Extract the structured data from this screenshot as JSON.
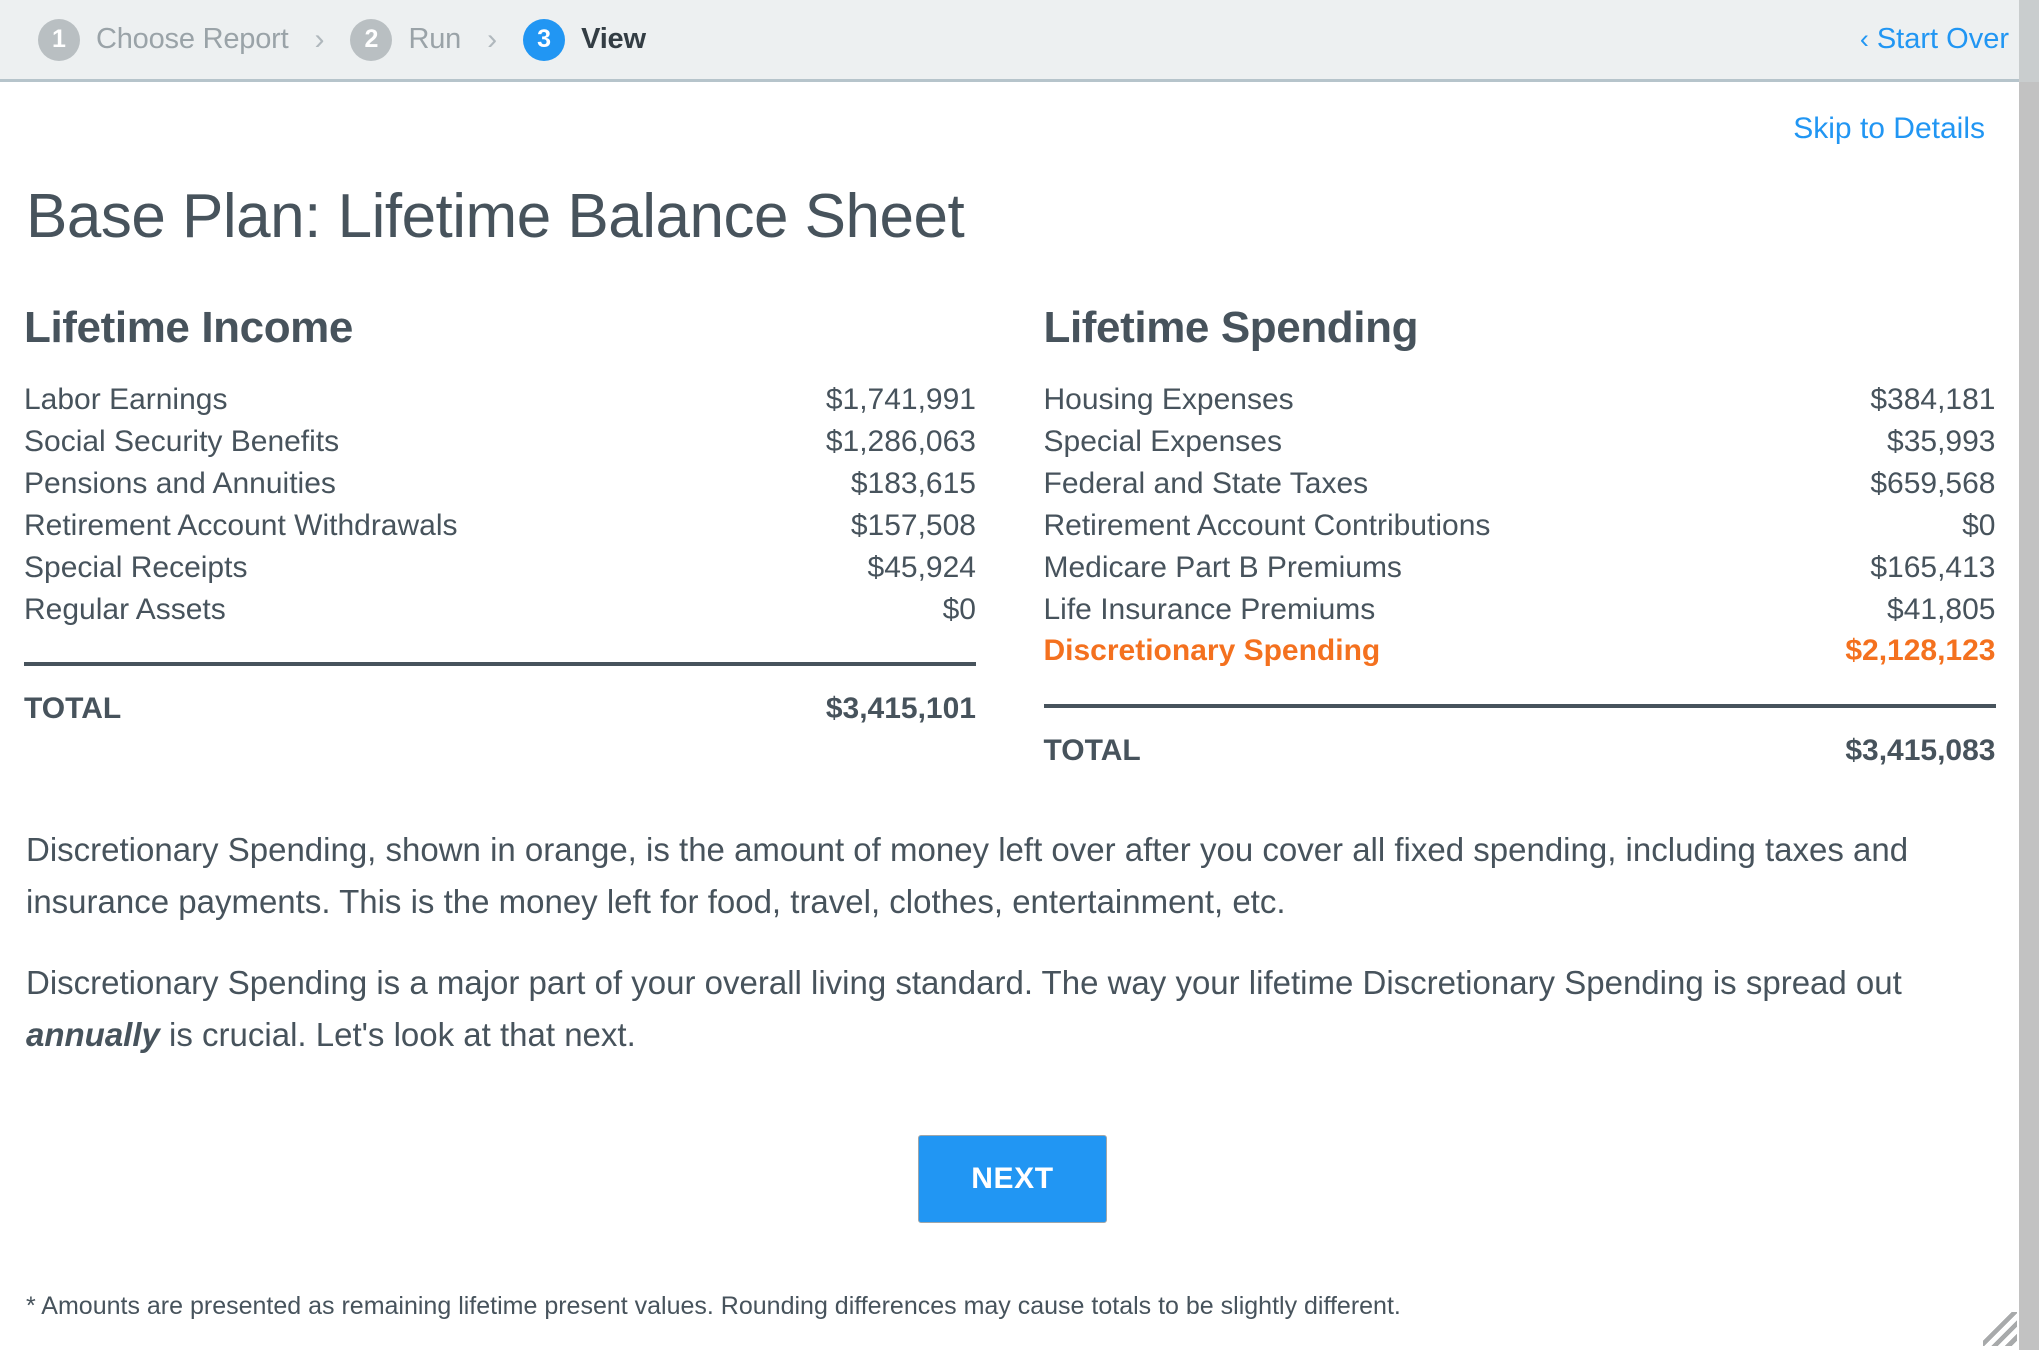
{
  "header": {
    "steps": [
      {
        "number": "1",
        "label": "Choose Report",
        "state": "inactive"
      },
      {
        "number": "2",
        "label": "Run",
        "state": "inactive"
      },
      {
        "number": "3",
        "label": "View",
        "state": "active"
      }
    ],
    "separator": "›",
    "start_over": {
      "chevron": "‹",
      "label": "Start Over"
    }
  },
  "main": {
    "skip_link": "Skip to Details",
    "title": "Base Plan: Lifetime Balance Sheet",
    "income": {
      "heading": "Lifetime Income",
      "rows": [
        {
          "label": "Labor Earnings",
          "value": "$1,741,991"
        },
        {
          "label": "Social Security Benefits",
          "value": "$1,286,063"
        },
        {
          "label": "Pensions and Annuities",
          "value": "$183,615"
        },
        {
          "label": "Retirement Account Withdrawals",
          "value": "$157,508"
        },
        {
          "label": "Special Receipts",
          "value": "$45,924"
        },
        {
          "label": "Regular Assets",
          "value": "$0"
        }
      ],
      "total_label": "TOTAL",
      "total_value": "$3,415,101"
    },
    "spending": {
      "heading": "Lifetime Spending",
      "rows": [
        {
          "label": "Housing Expenses",
          "value": "$384,181"
        },
        {
          "label": "Special Expenses",
          "value": "$35,993"
        },
        {
          "label": "Federal and State Taxes",
          "value": "$659,568"
        },
        {
          "label": "Retirement Account Contributions",
          "value": "$0"
        },
        {
          "label": "Medicare Part B Premiums",
          "value": "$165,413"
        },
        {
          "label": "Life Insurance Premiums",
          "value": "$41,805"
        },
        {
          "label": "Discretionary Spending",
          "value": "$2,128,123",
          "highlight": true
        }
      ],
      "total_label": "TOTAL",
      "total_value": "$3,415,083"
    },
    "paragraph_1": "Discretionary Spending, shown in orange, is the amount of money left over after you cover all fixed spending, including taxes and insurance payments. This is the money left for food, travel, clothes, entertainment, etc.",
    "paragraph_2_part_1": "Discretionary Spending is a major part of your overall living standard. The way your lifetime Discretionary Spending is spread out ",
    "paragraph_2_emphasis": "annually",
    "paragraph_2_part_2": " is crucial. Let's look at that next.",
    "next_button": "NEXT",
    "footnote": "* Amounts are presented as remaining lifetime present values. Rounding differences may cause totals to be slightly different."
  },
  "colors": {
    "accent_blue": "#2196f3",
    "orange": "#f4711f",
    "text_slate": "#47535c",
    "header_bg": "#edf0f1"
  }
}
